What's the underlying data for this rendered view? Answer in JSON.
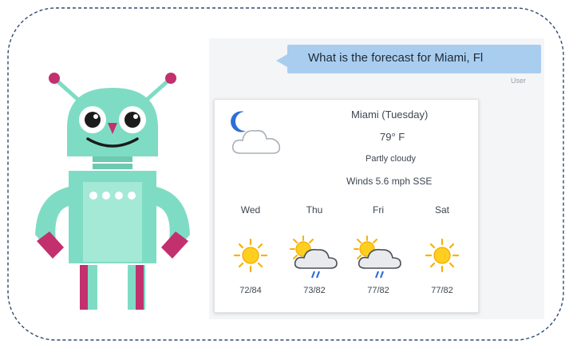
{
  "chat": {
    "user_message": "What is the forecast for Miami, Fl",
    "user_label": "User"
  },
  "weather": {
    "title": "Miami (Tuesday)",
    "temperature": "79° F",
    "condition": "Partly cloudy",
    "winds": "Winds 5.6 mph SSE",
    "current_icon": "moon-cloud-icon",
    "forecast": [
      {
        "day": "Wed",
        "range": "72/84",
        "icon": "sun-icon"
      },
      {
        "day": "Thu",
        "range": "73/82",
        "icon": "sun-cloud-rain-icon"
      },
      {
        "day": "Fri",
        "range": "77/82",
        "icon": "sun-cloud-rain-icon"
      },
      {
        "day": "Sat",
        "range": "77/82",
        "icon": "sun-icon"
      }
    ]
  },
  "colors": {
    "bubble": "#a9cdef",
    "robot_body": "#7fdcc4",
    "robot_accent": "#c2306e",
    "frame_border": "#2f4a73"
  }
}
